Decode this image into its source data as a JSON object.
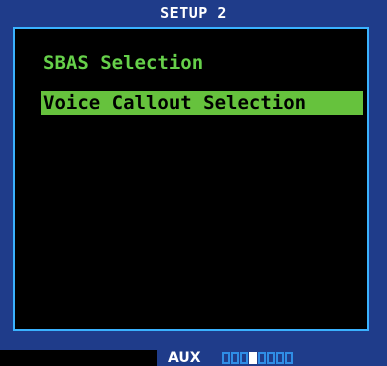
{
  "window": {
    "title": "SETUP 2"
  },
  "menu": {
    "items": [
      {
        "label": "SBAS Selection",
        "selected": false
      },
      {
        "label": "Voice Callout Selection",
        "selected": true
      }
    ]
  },
  "status": {
    "page_group": "AUX",
    "page_count": 8,
    "current_page": 4
  },
  "colors": {
    "background": "#1f3c8a",
    "panel_border": "#3ab2ff",
    "menu_text": "#66d04a",
    "highlight": "#66c23d"
  }
}
